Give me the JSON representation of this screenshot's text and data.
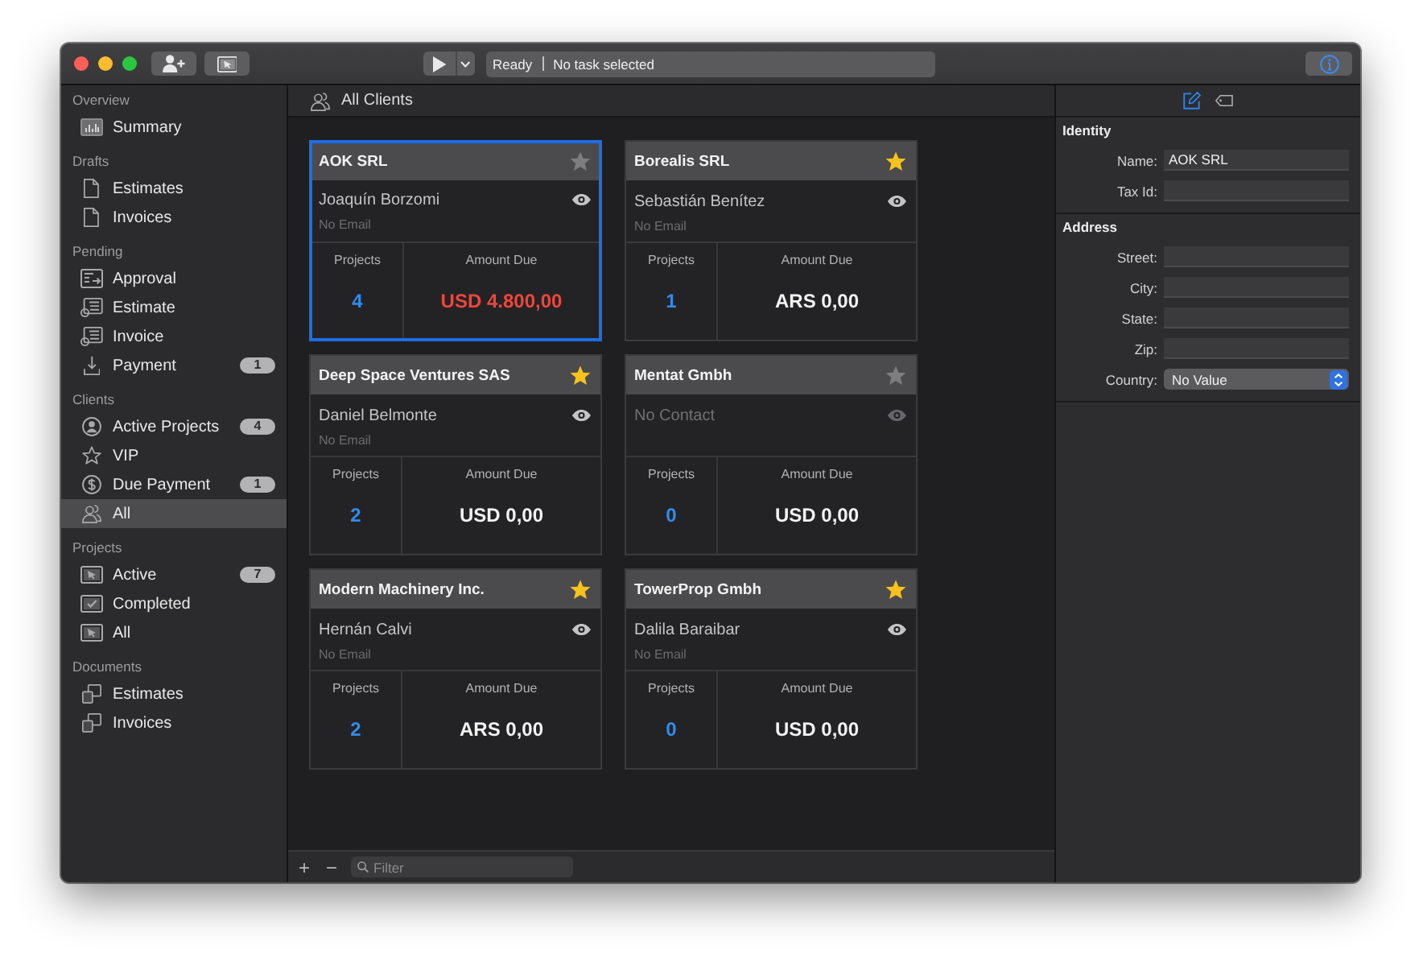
{
  "toolbar": {
    "status": "Ready",
    "task": "No task selected"
  },
  "sidebar": {
    "sections": [
      {
        "title": "Overview",
        "items": [
          {
            "label": "Summary",
            "kind": "bar-chart",
            "selected": false
          }
        ]
      },
      {
        "title": "Drafts",
        "items": [
          {
            "label": "Estimates",
            "kind": "document",
            "selected": false
          },
          {
            "label": "Invoices",
            "kind": "document",
            "selected": false
          }
        ]
      },
      {
        "title": "Pending",
        "items": [
          {
            "label": "Approval",
            "kind": "window-arrow",
            "selected": false
          },
          {
            "label": "Estimate",
            "kind": "window-badge",
            "selected": false
          },
          {
            "label": "Invoice",
            "kind": "window-badge",
            "selected": false
          },
          {
            "label": "Payment",
            "kind": "download",
            "selected": false,
            "badge": "1"
          }
        ]
      },
      {
        "title": "Clients",
        "items": [
          {
            "label": "Active Projects",
            "kind": "person-circle",
            "selected": false,
            "badge": "4"
          },
          {
            "label": "VIP",
            "kind": "star",
            "selected": false
          },
          {
            "label": "Due Payment",
            "kind": "dollar-circle",
            "selected": false,
            "badge": "1"
          },
          {
            "label": "All",
            "kind": "people",
            "selected": true
          }
        ]
      },
      {
        "title": "Projects",
        "items": [
          {
            "label": "Active",
            "kind": "window-cursor",
            "selected": false,
            "badge": "7"
          },
          {
            "label": "Completed",
            "kind": "window-check",
            "selected": false
          },
          {
            "label": "All",
            "kind": "window-cursor",
            "selected": false
          }
        ]
      },
      {
        "title": "Documents",
        "items": [
          {
            "label": "Estimates",
            "kind": "stacked-windows",
            "selected": false
          },
          {
            "label": "Invoices",
            "kind": "stacked-windows",
            "selected": false
          }
        ]
      }
    ]
  },
  "list": {
    "title": "All Clients",
    "clients": [
      {
        "name": "AOK SRL",
        "favorite": false,
        "selected": true,
        "contact": "Joaquín Borzomi",
        "has_contact": true,
        "email": "No Email",
        "projects_label": "Projects",
        "projects": "4",
        "amount_label": "Amount Due",
        "amount": "USD 4.800,00",
        "overdue": true
      },
      {
        "name": "Borealis SRL",
        "favorite": true,
        "selected": false,
        "contact": "Sebastián Benítez",
        "has_contact": true,
        "email": "No Email",
        "projects_label": "Projects",
        "projects": "1",
        "amount_label": "Amount Due",
        "amount": "ARS 0,00",
        "overdue": false
      },
      {
        "name": "Deep Space Ventures SAS",
        "favorite": true,
        "selected": false,
        "contact": "Daniel Belmonte",
        "has_contact": true,
        "email": "No Email",
        "projects_label": "Projects",
        "projects": "2",
        "amount_label": "Amount Due",
        "amount": "USD 0,00",
        "overdue": false
      },
      {
        "name": "Mentat Gmbh",
        "favorite": false,
        "selected": false,
        "contact": "No Contact",
        "has_contact": false,
        "projects_label": "Projects",
        "projects": "0",
        "amount_label": "Amount Due",
        "amount": "USD 0,00",
        "overdue": false
      },
      {
        "name": "Modern Machinery Inc.",
        "favorite": true,
        "selected": false,
        "contact": "Hernán Calvi",
        "has_contact": true,
        "email": "No Email",
        "projects_label": "Projects",
        "projects": "2",
        "amount_label": "Amount Due",
        "amount": "ARS 0,00",
        "overdue": false
      },
      {
        "name": "TowerProp Gmbh",
        "favorite": true,
        "selected": false,
        "contact": "Dalila Baraibar",
        "has_contact": true,
        "email": "No Email",
        "projects_label": "Projects",
        "projects": "0",
        "amount_label": "Amount Due",
        "amount": "USD 0,00",
        "overdue": false
      }
    ],
    "add": "+",
    "remove": "−",
    "filter": {
      "placeholder": "Filter"
    }
  },
  "inspector": {
    "tabs": [
      {
        "kind": "edit",
        "selected": true
      },
      {
        "kind": "tag",
        "selected": false
      }
    ],
    "sections": [
      {
        "title": "Identity",
        "fields": [
          {
            "kind": "text",
            "label": "Name:",
            "value": "AOK SRL"
          },
          {
            "kind": "text",
            "label": "Tax Id:"
          }
        ]
      },
      {
        "title": "Address",
        "fields": [
          {
            "kind": "text",
            "label": "Street:"
          },
          {
            "kind": "text",
            "label": "City:"
          },
          {
            "kind": "text",
            "label": "State:"
          },
          {
            "kind": "text",
            "label": "Zip:"
          },
          {
            "kind": "popup",
            "label": "Country:",
            "value": "No Value"
          }
        ]
      }
    ]
  }
}
